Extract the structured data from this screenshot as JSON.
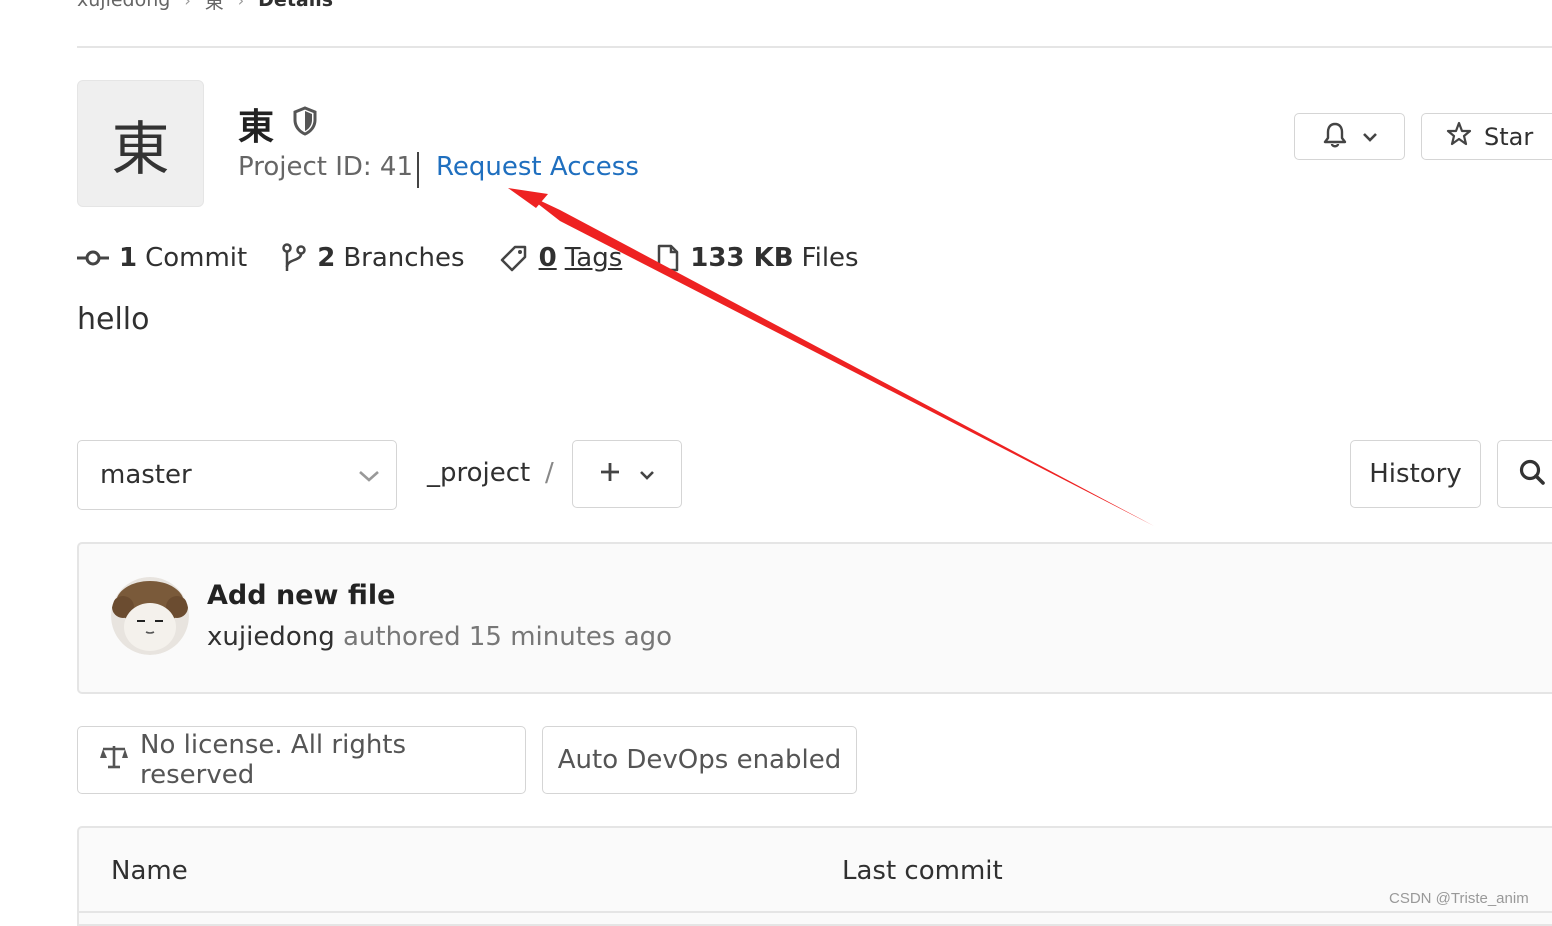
{
  "breadcrumb": {
    "user": "xujiedong",
    "project": "東",
    "current": "Details"
  },
  "project": {
    "avatar_letter": "東",
    "name": "東",
    "id_text": "Project ID: 41",
    "request_access": "Request Access",
    "description": "hello"
  },
  "header_buttons": {
    "star_label": "Star"
  },
  "stats": {
    "commits_count": "1",
    "commits_label": "Commit",
    "branches_count": "2",
    "branches_label": "Branches",
    "tags_count": "0",
    "tags_label": "Tags",
    "files_size": "133 KB",
    "files_label": "Files"
  },
  "tree_nav": {
    "branch": "master",
    "path_project": "_project",
    "path_separator": "/",
    "history_label": "History"
  },
  "last_commit": {
    "title": "Add new file",
    "author": "xujiedong",
    "meta": "authored 15 minutes ago"
  },
  "badges": {
    "license": "No license. All rights reserved",
    "devops": "Auto DevOps enabled"
  },
  "file_table": {
    "col_name": "Name",
    "col_last_commit": "Last commit"
  },
  "watermark": "CSDN @Triste_anim",
  "annotation": {
    "arrow_color": "#ee2222"
  }
}
